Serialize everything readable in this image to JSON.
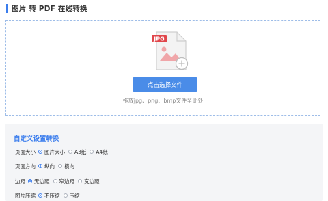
{
  "header": {
    "title": "图片 转 PDF 在线转换"
  },
  "upload": {
    "badge": "JPG",
    "button_label": "点击选择文件",
    "hint": "拖放jpg、png、bmp文件至此处"
  },
  "settings": {
    "title": "自定义设置转换",
    "rows": [
      {
        "label": "页面大小",
        "options": [
          {
            "label": "图片大小",
            "selected": true
          },
          {
            "label": "A3纸",
            "selected": false
          },
          {
            "label": "A4纸",
            "selected": false
          }
        ]
      },
      {
        "label": "页面方向",
        "options": [
          {
            "label": "纵向",
            "selected": true
          },
          {
            "label": "横向",
            "selected": false
          }
        ]
      },
      {
        "label": "边距",
        "options": [
          {
            "label": "无边距",
            "selected": true
          },
          {
            "label": "窄边距",
            "selected": false
          },
          {
            "label": "宽边距",
            "selected": false
          }
        ]
      },
      {
        "label": "图片压缩",
        "options": [
          {
            "label": "不压缩",
            "selected": true
          },
          {
            "label": "压缩",
            "selected": false
          }
        ]
      }
    ]
  },
  "colors": {
    "accent": "#3b7ded",
    "button": "#4a8ce8",
    "badge": "#e0464b",
    "panel": "#f4f5f7"
  }
}
